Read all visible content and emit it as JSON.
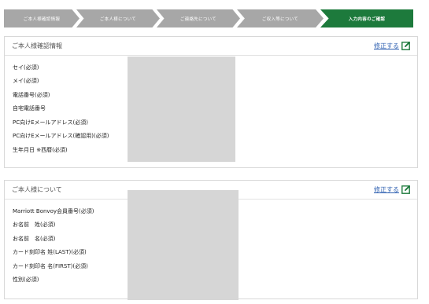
{
  "steps": [
    {
      "label": "ご本人様確認情報",
      "active": false
    },
    {
      "label": "ご本人様について",
      "active": false
    },
    {
      "label": "ご連絡先について",
      "active": false
    },
    {
      "label": "ご収入等について",
      "active": false
    },
    {
      "label": "入力内容のご確認",
      "active": true
    }
  ],
  "colors": {
    "active_step": "#1d7a3c",
    "inactive_step": "#a7a7a7",
    "link": "#2d5fb0"
  },
  "sections": [
    {
      "title": "ご本人様確認情報",
      "edit_label": "修正する",
      "fields": [
        "セイ(必須)",
        "メイ(必須)",
        "電話番号(必須)",
        "自宅電話番号",
        "PC向けEメールアドレス(必須)",
        "PC向けEメールアドレス(確認用)(必須)",
        "生年月日 ※西暦(必須)"
      ]
    },
    {
      "title": "ご本人様について",
      "edit_label": "修正する",
      "fields": [
        "Marriott Bonvoy会員番号(必須)",
        "お名前　姓(必須)",
        "お名前　名(必須)",
        "カード刻印名 姓(LAST)(必須)",
        "カード刻印名 名(FIRST)(必須)",
        "性別(必須)"
      ]
    }
  ]
}
